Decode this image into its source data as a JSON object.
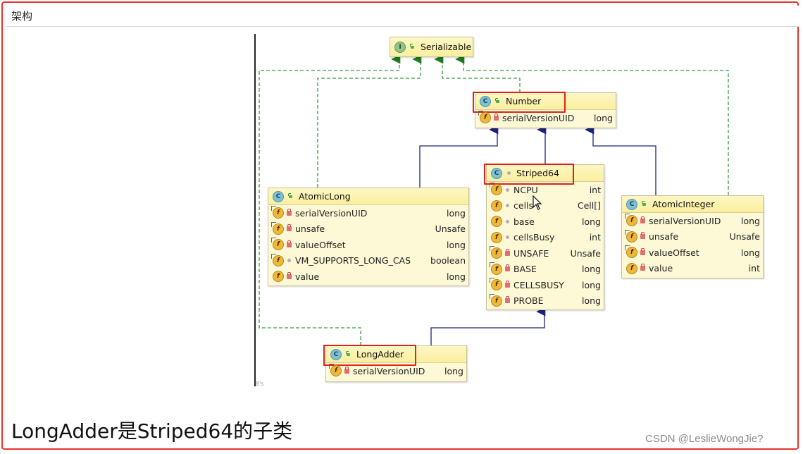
{
  "header": {
    "title": "架构"
  },
  "caption": "LongAdder是Striped64的子类",
  "watermark": "CSDN @LeslieWongJie?",
  "page_mark": "8's",
  "classes": {
    "serializable": {
      "name": "Serializable",
      "kind": "I",
      "fields": []
    },
    "number": {
      "name": "Number",
      "kind": "C",
      "fields": [
        {
          "name": "serialVersionUID",
          "type": "long"
        }
      ]
    },
    "striped64": {
      "name": "Striped64",
      "kind": "C",
      "fields": [
        {
          "name": "NCPU",
          "type": "int"
        },
        {
          "name": "cells",
          "type": "Cell[]"
        },
        {
          "name": "base",
          "type": "long"
        },
        {
          "name": "cellsBusy",
          "type": "int"
        },
        {
          "name": "UNSAFE",
          "type": "Unsafe"
        },
        {
          "name": "BASE",
          "type": "long"
        },
        {
          "name": "CELLSBUSY",
          "type": "long"
        },
        {
          "name": "PROBE",
          "type": "long"
        }
      ]
    },
    "atomicLong": {
      "name": "AtomicLong",
      "kind": "C",
      "fields": [
        {
          "name": "serialVersionUID",
          "type": "long"
        },
        {
          "name": "unsafe",
          "type": "Unsafe"
        },
        {
          "name": "valueOffset",
          "type": "long"
        },
        {
          "name": "VM_SUPPORTS_LONG_CAS",
          "type": "boolean"
        },
        {
          "name": "value",
          "type": "long"
        }
      ]
    },
    "atomicInteger": {
      "name": "AtomicInteger",
      "kind": "C",
      "fields": [
        {
          "name": "serialVersionUID",
          "type": "long"
        },
        {
          "name": "unsafe",
          "type": "Unsafe"
        },
        {
          "name": "valueOffset",
          "type": "long"
        },
        {
          "name": "value",
          "type": "int"
        }
      ]
    },
    "longAdder": {
      "name": "LongAdder",
      "kind": "C",
      "fields": [
        {
          "name": "serialVersionUID",
          "type": "long"
        }
      ]
    }
  },
  "colors": {
    "frame": "#e8332c",
    "implements_edge": "#2e8b2e",
    "extends_edge": "#1a237e",
    "highlight": "#e0221b",
    "node_fill": "#fdf9d6"
  }
}
